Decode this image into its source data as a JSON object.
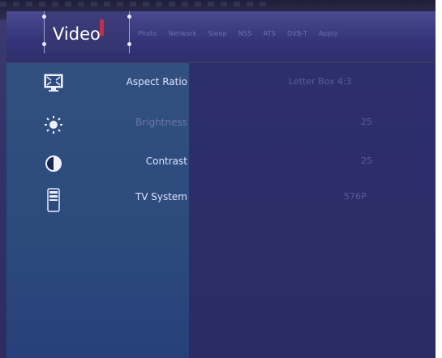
{
  "tabs": {
    "active": "Video",
    "items": [
      "Photo",
      "Network",
      "Sleep",
      "NSS",
      "ATS",
      "DVB-T",
      "Apply"
    ]
  },
  "settings": [
    {
      "label": "Aspect Ratio",
      "value": "Letter Box 4:3",
      "icon": "monitor-icon",
      "state": "active"
    },
    {
      "label": "Brightness",
      "value": "25",
      "icon": "sun-icon",
      "state": "dim"
    },
    {
      "label": "Contrast",
      "value": "25",
      "icon": "contrast-icon",
      "state": "active"
    },
    {
      "label": "TV System",
      "value": "576P",
      "icon": "tv-system-icon",
      "state": "active"
    }
  ],
  "colors": {
    "sidebar": "#2c4a7c",
    "content": "#2b2c66",
    "tabbar": "#34347a"
  }
}
